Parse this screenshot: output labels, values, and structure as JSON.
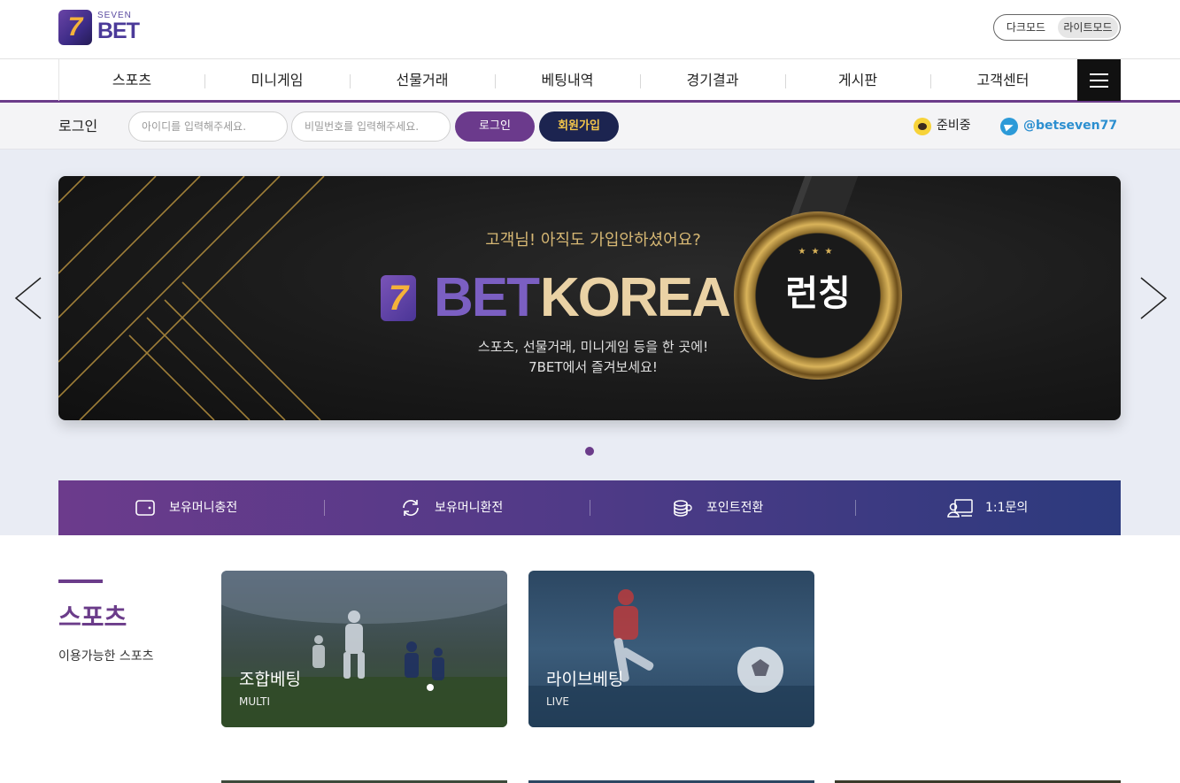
{
  "header": {
    "logo_small": "SEVEN",
    "logo_big": "BET",
    "logo_mark": "7",
    "mode_dark": "다크모드",
    "mode_light": "라이트모드"
  },
  "nav": {
    "items": [
      "스포츠",
      "미니게임",
      "선물거래",
      "베팅내역",
      "경기결과",
      "게시판",
      "고객센터"
    ],
    "menu_icon": "hamburger-icon"
  },
  "login": {
    "label": "로그인",
    "id_placeholder": "아이디를 입력해주세요.",
    "pw_placeholder": "비밀번호를 입력해주세요.",
    "login_button": "로그인",
    "join_button": "회원가입",
    "kakao_text": "준비중",
    "telegram_text": "@betseven77"
  },
  "banner": {
    "subtitle": "고객님! 아직도 가입안하셨어요?",
    "logo_mark": "7",
    "brand_bet": "BET",
    "brand_korea": "KOREA",
    "desc_line1": "스포츠, 선물거래, 미니게임 등을 한 곳에!",
    "desc_line2": "7BET에서 즐겨보세요!",
    "medal_text": "런칭",
    "medal_stars": "★★★"
  },
  "quick_menu": {
    "items": [
      {
        "label": "보유머니충전",
        "icon": "wallet-icon"
      },
      {
        "label": "보유머니환전",
        "icon": "refresh-icon"
      },
      {
        "label": "포인트전환",
        "icon": "coins-icon"
      },
      {
        "label": "1:1문의",
        "icon": "support-icon"
      }
    ]
  },
  "sports": {
    "title": "스포츠",
    "subtitle": "이용가능한 스포츠",
    "cards": [
      {
        "title": "조합베팅",
        "sub": "MULTI"
      },
      {
        "title": "라이브베팅",
        "sub": "LIVE"
      }
    ]
  },
  "colors": {
    "brand_purple": "#6b3c8a",
    "navy": "#1c2450",
    "gold": "#f4c64a"
  }
}
